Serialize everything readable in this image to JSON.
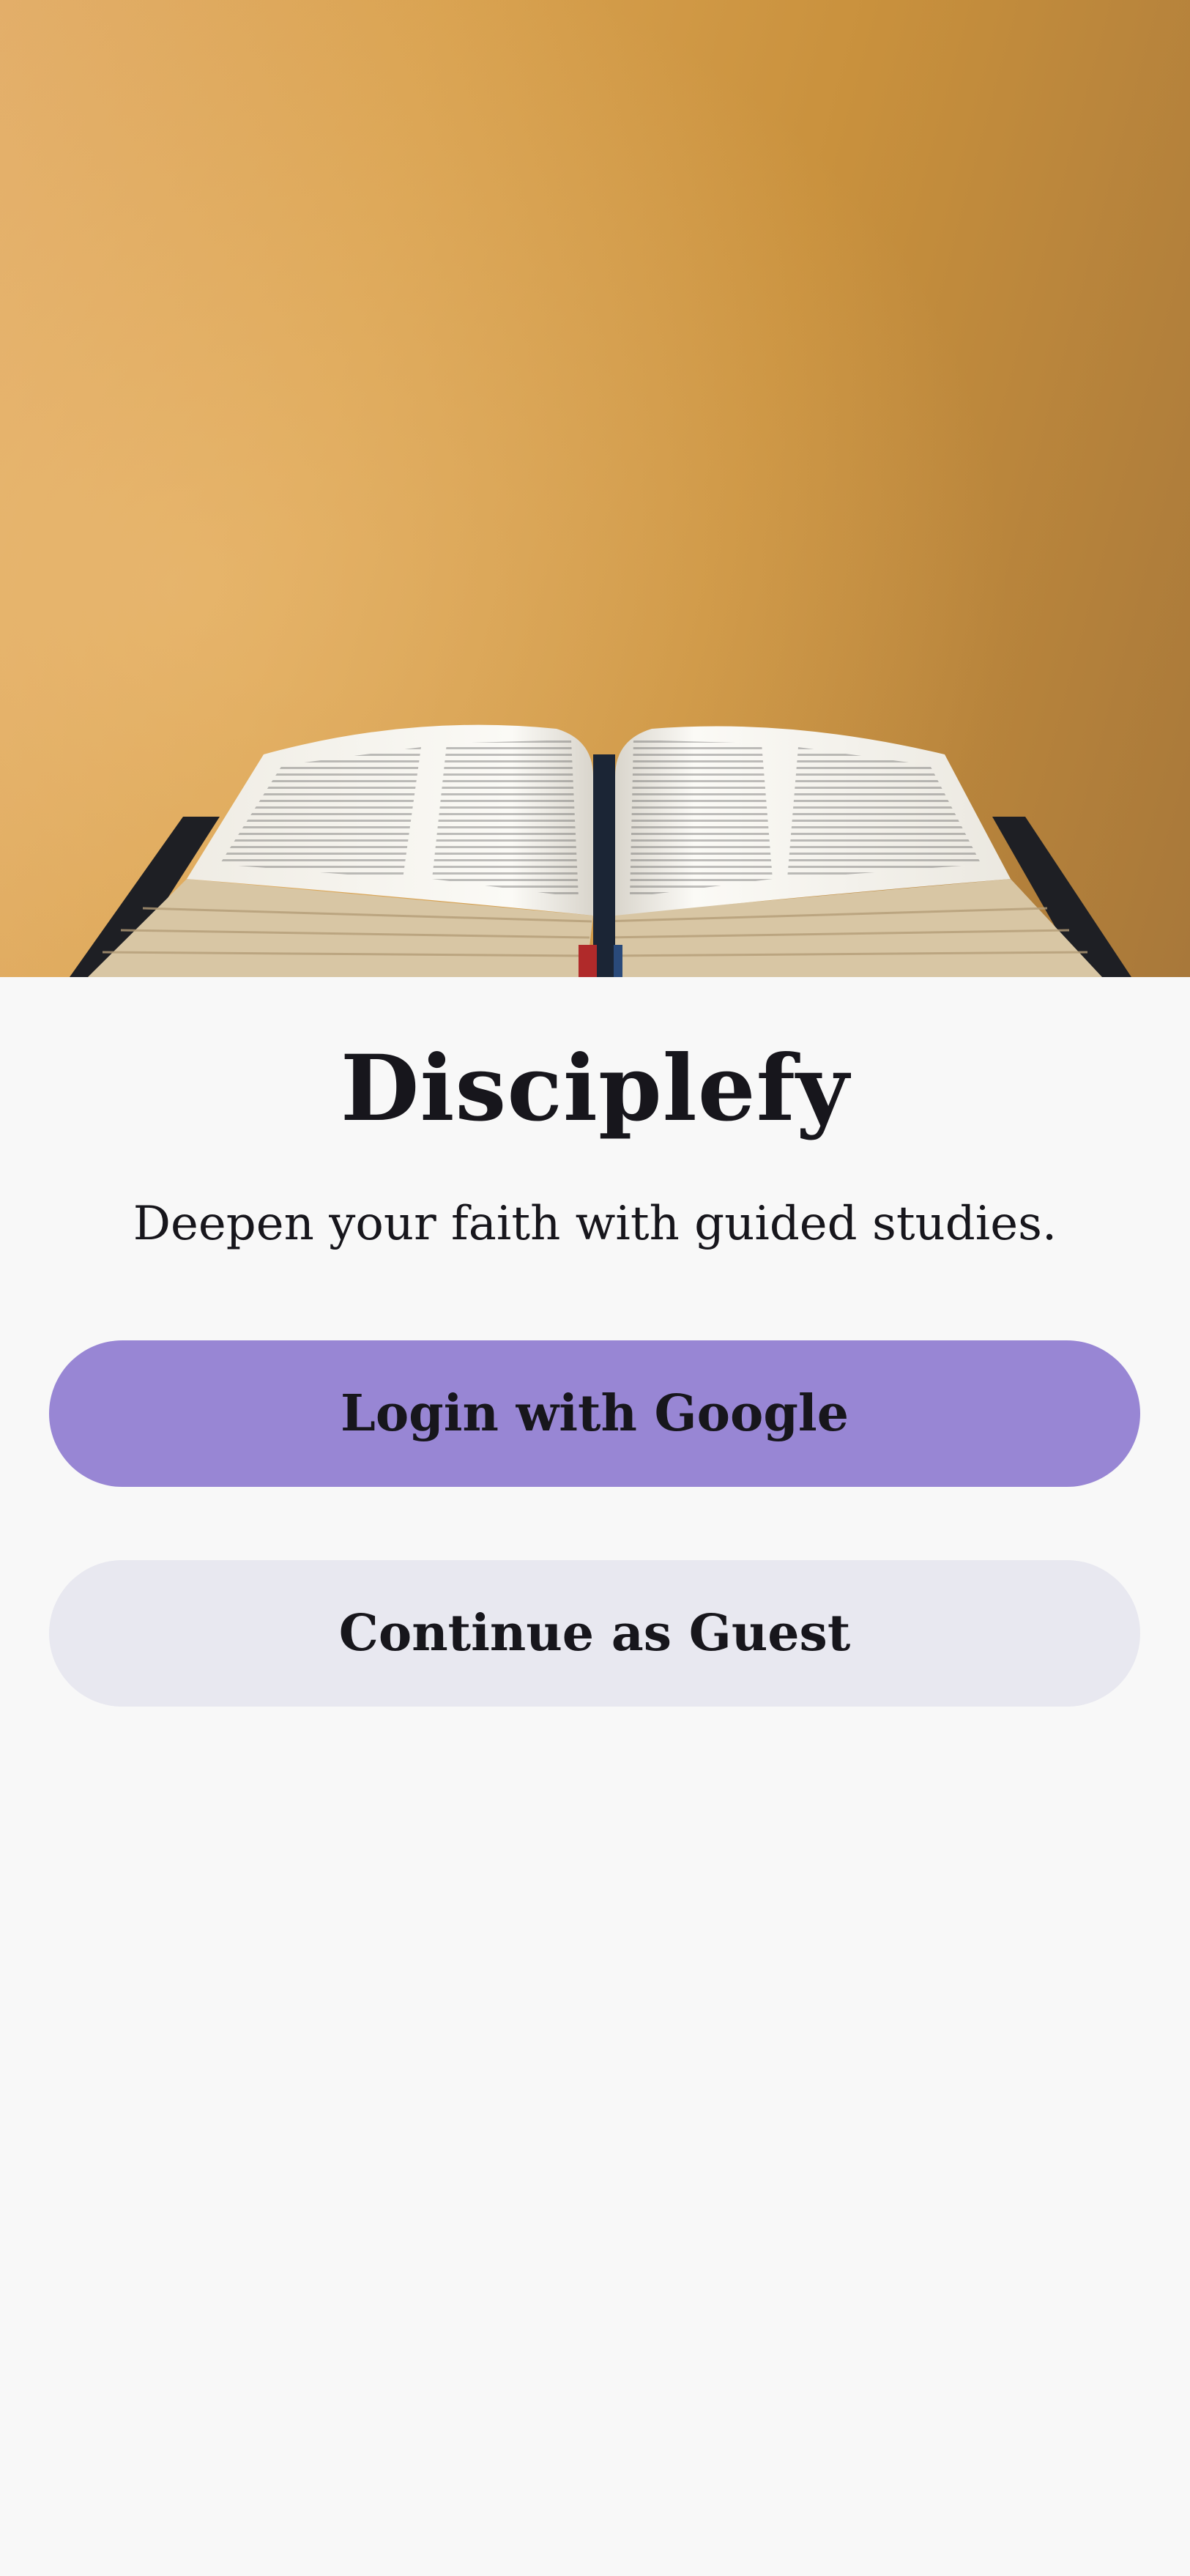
{
  "app": {
    "title": "Disciplefy",
    "tagline": "Deepen your faith with guided studies."
  },
  "actions": {
    "google_login_label": "Login with Google",
    "guest_label": "Continue as Guest"
  },
  "hero": {
    "image": "open-bible-photo",
    "background_color": "#d9a250"
  },
  "colors": {
    "primary_button": "#9886d4",
    "secondary_button": "#e8e8f0",
    "text": "#17161c",
    "page_background": "#f8f8f8"
  }
}
